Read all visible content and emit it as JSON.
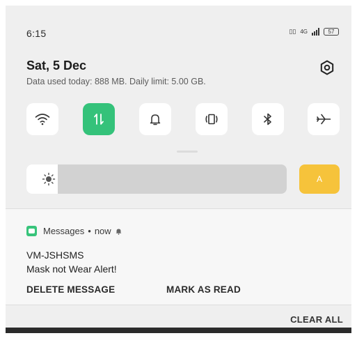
{
  "status_bar": {
    "time": "6:15",
    "volte": "VoLTE",
    "network": "4G",
    "battery": "57"
  },
  "header": {
    "date": "Sat, 5 Dec",
    "data_usage": "Data used today: 888 MB. Daily limit: 5.00 GB."
  },
  "quick_settings": [
    {
      "name": "wifi",
      "icon": "wifi-icon",
      "active": false
    },
    {
      "name": "mobile-data",
      "icon": "mobile-data-icon",
      "active": true
    },
    {
      "name": "sound",
      "icon": "bell-icon",
      "active": false
    },
    {
      "name": "vibrate",
      "icon": "vibrate-icon",
      "active": false
    },
    {
      "name": "bluetooth",
      "icon": "bluetooth-icon",
      "active": false
    },
    {
      "name": "airplane-mode",
      "icon": "airplane-icon",
      "active": false
    }
  ],
  "brightness": {
    "level": 0.12,
    "auto_label": "A"
  },
  "notification": {
    "app": "Messages",
    "separator": "•",
    "time": "now",
    "title": "VM-JSHSMS",
    "body": "Mask not Wear Alert!",
    "actions": [
      "DELETE MESSAGE",
      "MARK AS READ"
    ]
  },
  "clear_all_label": "CLEAR ALL",
  "colors": {
    "accent_green": "#34c27a",
    "auto_yellow": "#f6c33b",
    "panel_background": "#efefef"
  }
}
